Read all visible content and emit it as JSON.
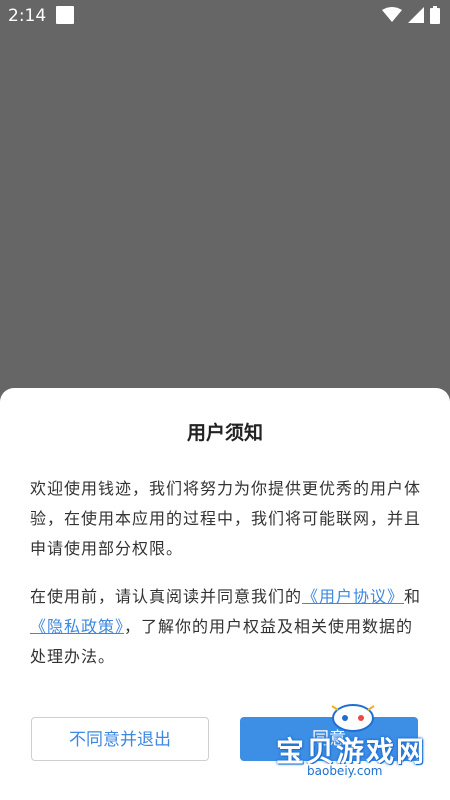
{
  "status_bar": {
    "time": "2:14"
  },
  "dialog": {
    "title": "用户须知",
    "paragraph1": "欢迎使用钱迹，我们将努力为你提供更优秀的用户体验，在使用本应用的过程中，我们将可能联网，并且申请使用部分权限。",
    "paragraph2_prefix": "在使用前，请认真阅读并同意我们的",
    "link_user_agreement": "《用户协议》",
    "paragraph2_and": "和",
    "link_privacy_policy": "《隐私政策》",
    "paragraph2_suffix": "，了解你的用户权益及相关使用数据的处理办法。",
    "disagree_button": "不同意并退出",
    "agree_button": "同意"
  },
  "watermark": {
    "text": "宝贝游戏网",
    "url": "baobeiy.com"
  },
  "colors": {
    "accent": "#3d88e0",
    "overlay": "#666666",
    "button_fill": "#3d8fe6"
  }
}
